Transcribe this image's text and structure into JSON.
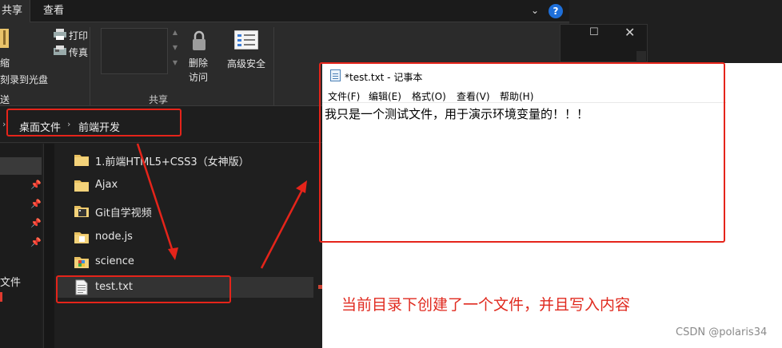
{
  "explorer": {
    "tabs": {
      "share": "共享",
      "view": "查看"
    },
    "ribbon": {
      "compress_label": "缩",
      "burn_label": "刻录到光盘",
      "send_label": "送",
      "print_label": "打印",
      "fax_label": "传真",
      "remove_access_line1": "删除",
      "remove_access_line2": "访问",
      "advanced_security": "高级安全",
      "group_share": "共享"
    },
    "breadcrumb": [
      "桌面文件",
      "前端开发"
    ],
    "nav": {
      "partial_label": "文件"
    },
    "files": [
      {
        "name": "1.前端HTML5+CSS3（女神版）",
        "icon": "folder-icon"
      },
      {
        "name": "Ajax",
        "icon": "folder-icon"
      },
      {
        "name": "Git自学视频",
        "icon": "folder-video-icon"
      },
      {
        "name": "node.js",
        "icon": "folder-icon"
      },
      {
        "name": "science",
        "icon": "folder-image-icon"
      },
      {
        "name": "test.txt",
        "icon": "text-file-icon"
      }
    ]
  },
  "notepad": {
    "title": "*test.txt - 记事本",
    "menu": [
      "文件(F)",
      "编辑(E)",
      "格式(O)",
      "查看(V)",
      "帮助(H)"
    ],
    "content": "我只是一个测试文件，用于演示环境变量的！！！"
  },
  "annotation": "当前目录下创建了一个文件，并且写入内容",
  "watermark": "CSDN @polaris34",
  "colors": {
    "highlight": "#e5241a",
    "help_badge": "#1e6fd9"
  }
}
